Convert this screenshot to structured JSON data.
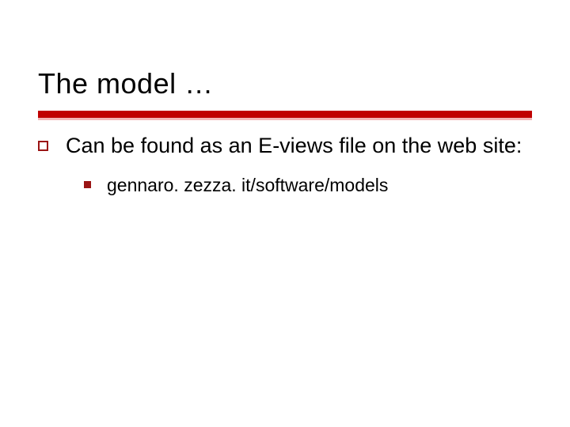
{
  "title": "The model …",
  "bullets": {
    "lvl1_text": "Can be found as an E-views file on the web site:",
    "lvl2_text": "gennaro. zezza. it/software/models"
  }
}
